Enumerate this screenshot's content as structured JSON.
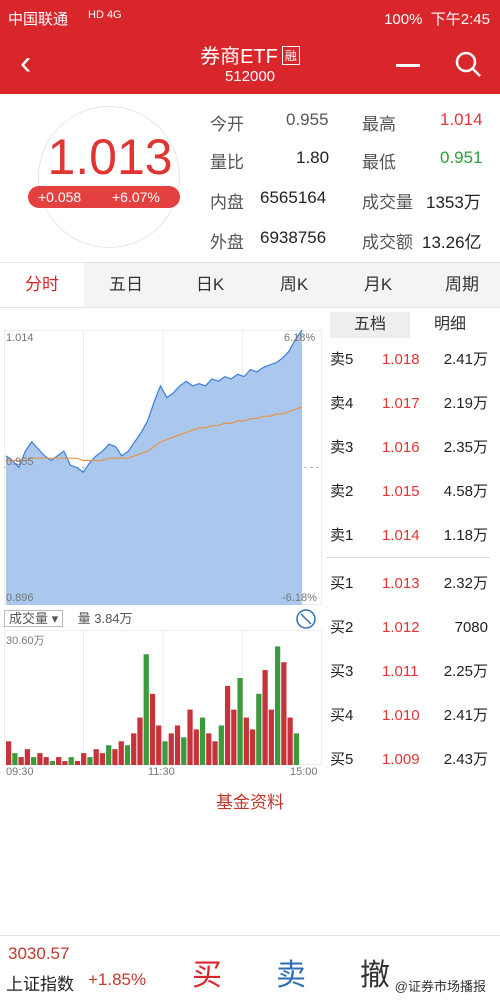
{
  "status": {
    "carrier": "中国联通",
    "signal": "HD 4G",
    "battery": "100%",
    "time": "下午2:45"
  },
  "header": {
    "title": "券商ETF",
    "tag": "融",
    "code": "512000"
  },
  "quote": {
    "price": "1.013",
    "change": "+0.058",
    "change_pct": "+6.07%",
    "fields": [
      {
        "label": "今开",
        "value": "0.955",
        "color": "#555"
      },
      {
        "label": "最高",
        "value": "1.014",
        "color": "#e03535"
      },
      {
        "label": "量比",
        "value": "1.80",
        "color": "#222"
      },
      {
        "label": "最低",
        "value": "0.951",
        "color": "#2f9e3a"
      },
      {
        "label": "内盘",
        "value": "6565164",
        "color": "#222"
      },
      {
        "label": "成交量",
        "value": "1353万",
        "color": "#222"
      },
      {
        "label": "外盘",
        "value": "6938756",
        "color": "#222"
      },
      {
        "label": "成交额",
        "value": "13.26亿",
        "color": "#222"
      }
    ]
  },
  "tabs": [
    "分时",
    "五日",
    "日K",
    "周K",
    "月K",
    "周期"
  ],
  "book_tabs": [
    "五档",
    "明细"
  ],
  "sells": [
    {
      "label": "卖5",
      "price": "1.018",
      "vol": "2.41万"
    },
    {
      "label": "卖4",
      "price": "1.017",
      "vol": "2.19万"
    },
    {
      "label": "卖3",
      "price": "1.016",
      "vol": "2.35万"
    },
    {
      "label": "卖2",
      "price": "1.015",
      "vol": "4.58万"
    },
    {
      "label": "卖1",
      "price": "1.014",
      "vol": "1.18万"
    }
  ],
  "buys": [
    {
      "label": "买1",
      "price": "1.013",
      "vol": "2.32万"
    },
    {
      "label": "买2",
      "price": "1.012",
      "vol": "7080"
    },
    {
      "label": "买3",
      "price": "1.011",
      "vol": "2.25万"
    },
    {
      "label": "买4",
      "price": "1.010",
      "vol": "2.41万"
    },
    {
      "label": "买5",
      "price": "1.009",
      "vol": "2.43万"
    }
  ],
  "chart": {
    "high": "1.014",
    "mid": "0.955",
    "low": "0.896",
    "pct_high": "6.18%",
    "pct_low": "-6.18%",
    "vol_label": "成交量",
    "vol_value": "量 3.84万",
    "vol_max": "30.60万",
    "time_start": "09:30",
    "time_mid": "11:30",
    "time_end": "15:00"
  },
  "fund_link": "基金资料",
  "bottom": {
    "index_value": "3030.57",
    "index_name": "上证指数",
    "index_pct": "+1.85%",
    "buy": "买",
    "sell": "卖",
    "cancel": "撤",
    "watermark": "@证券市场播报"
  },
  "chart_data": {
    "type": "line",
    "ylim": [
      0.896,
      1.014
    ],
    "price": [
      0.96,
      0.958,
      0.955,
      0.962,
      0.966,
      0.963,
      0.96,
      0.958,
      0.96,
      0.962,
      0.956,
      0.955,
      0.953,
      0.957,
      0.96,
      0.962,
      0.965,
      0.964,
      0.96,
      0.962,
      0.966,
      0.97,
      0.975,
      0.983,
      0.99,
      0.985,
      0.987,
      0.99,
      0.992,
      0.99,
      0.991,
      0.99,
      0.993,
      0.992,
      0.994,
      0.993,
      0.995,
      0.994,
      0.997,
      0.996,
      0.998,
      0.999,
      1.0,
      1.002,
      1.005,
      1.01,
      1.014
    ],
    "avg": [
      0.958,
      0.958,
      0.958,
      0.958,
      0.959,
      0.959,
      0.959,
      0.959,
      0.959,
      0.959,
      0.959,
      0.959,
      0.958,
      0.958,
      0.958,
      0.958,
      0.959,
      0.959,
      0.959,
      0.959,
      0.96,
      0.961,
      0.962,
      0.964,
      0.966,
      0.967,
      0.968,
      0.969,
      0.97,
      0.971,
      0.972,
      0.972,
      0.973,
      0.973,
      0.974,
      0.974,
      0.975,
      0.975,
      0.976,
      0.976,
      0.977,
      0.977,
      0.978,
      0.978,
      0.979,
      0.98,
      0.981
    ],
    "volume": [
      6,
      3,
      2,
      4,
      2,
      3,
      2,
      1,
      2,
      1,
      2,
      1,
      3,
      2,
      4,
      3,
      5,
      4,
      6,
      5,
      8,
      12,
      28,
      18,
      10,
      6,
      8,
      10,
      7,
      14,
      9,
      12,
      8,
      6,
      10,
      20,
      14,
      22,
      12,
      9,
      18,
      24,
      14,
      30,
      26,
      12,
      8
    ]
  }
}
